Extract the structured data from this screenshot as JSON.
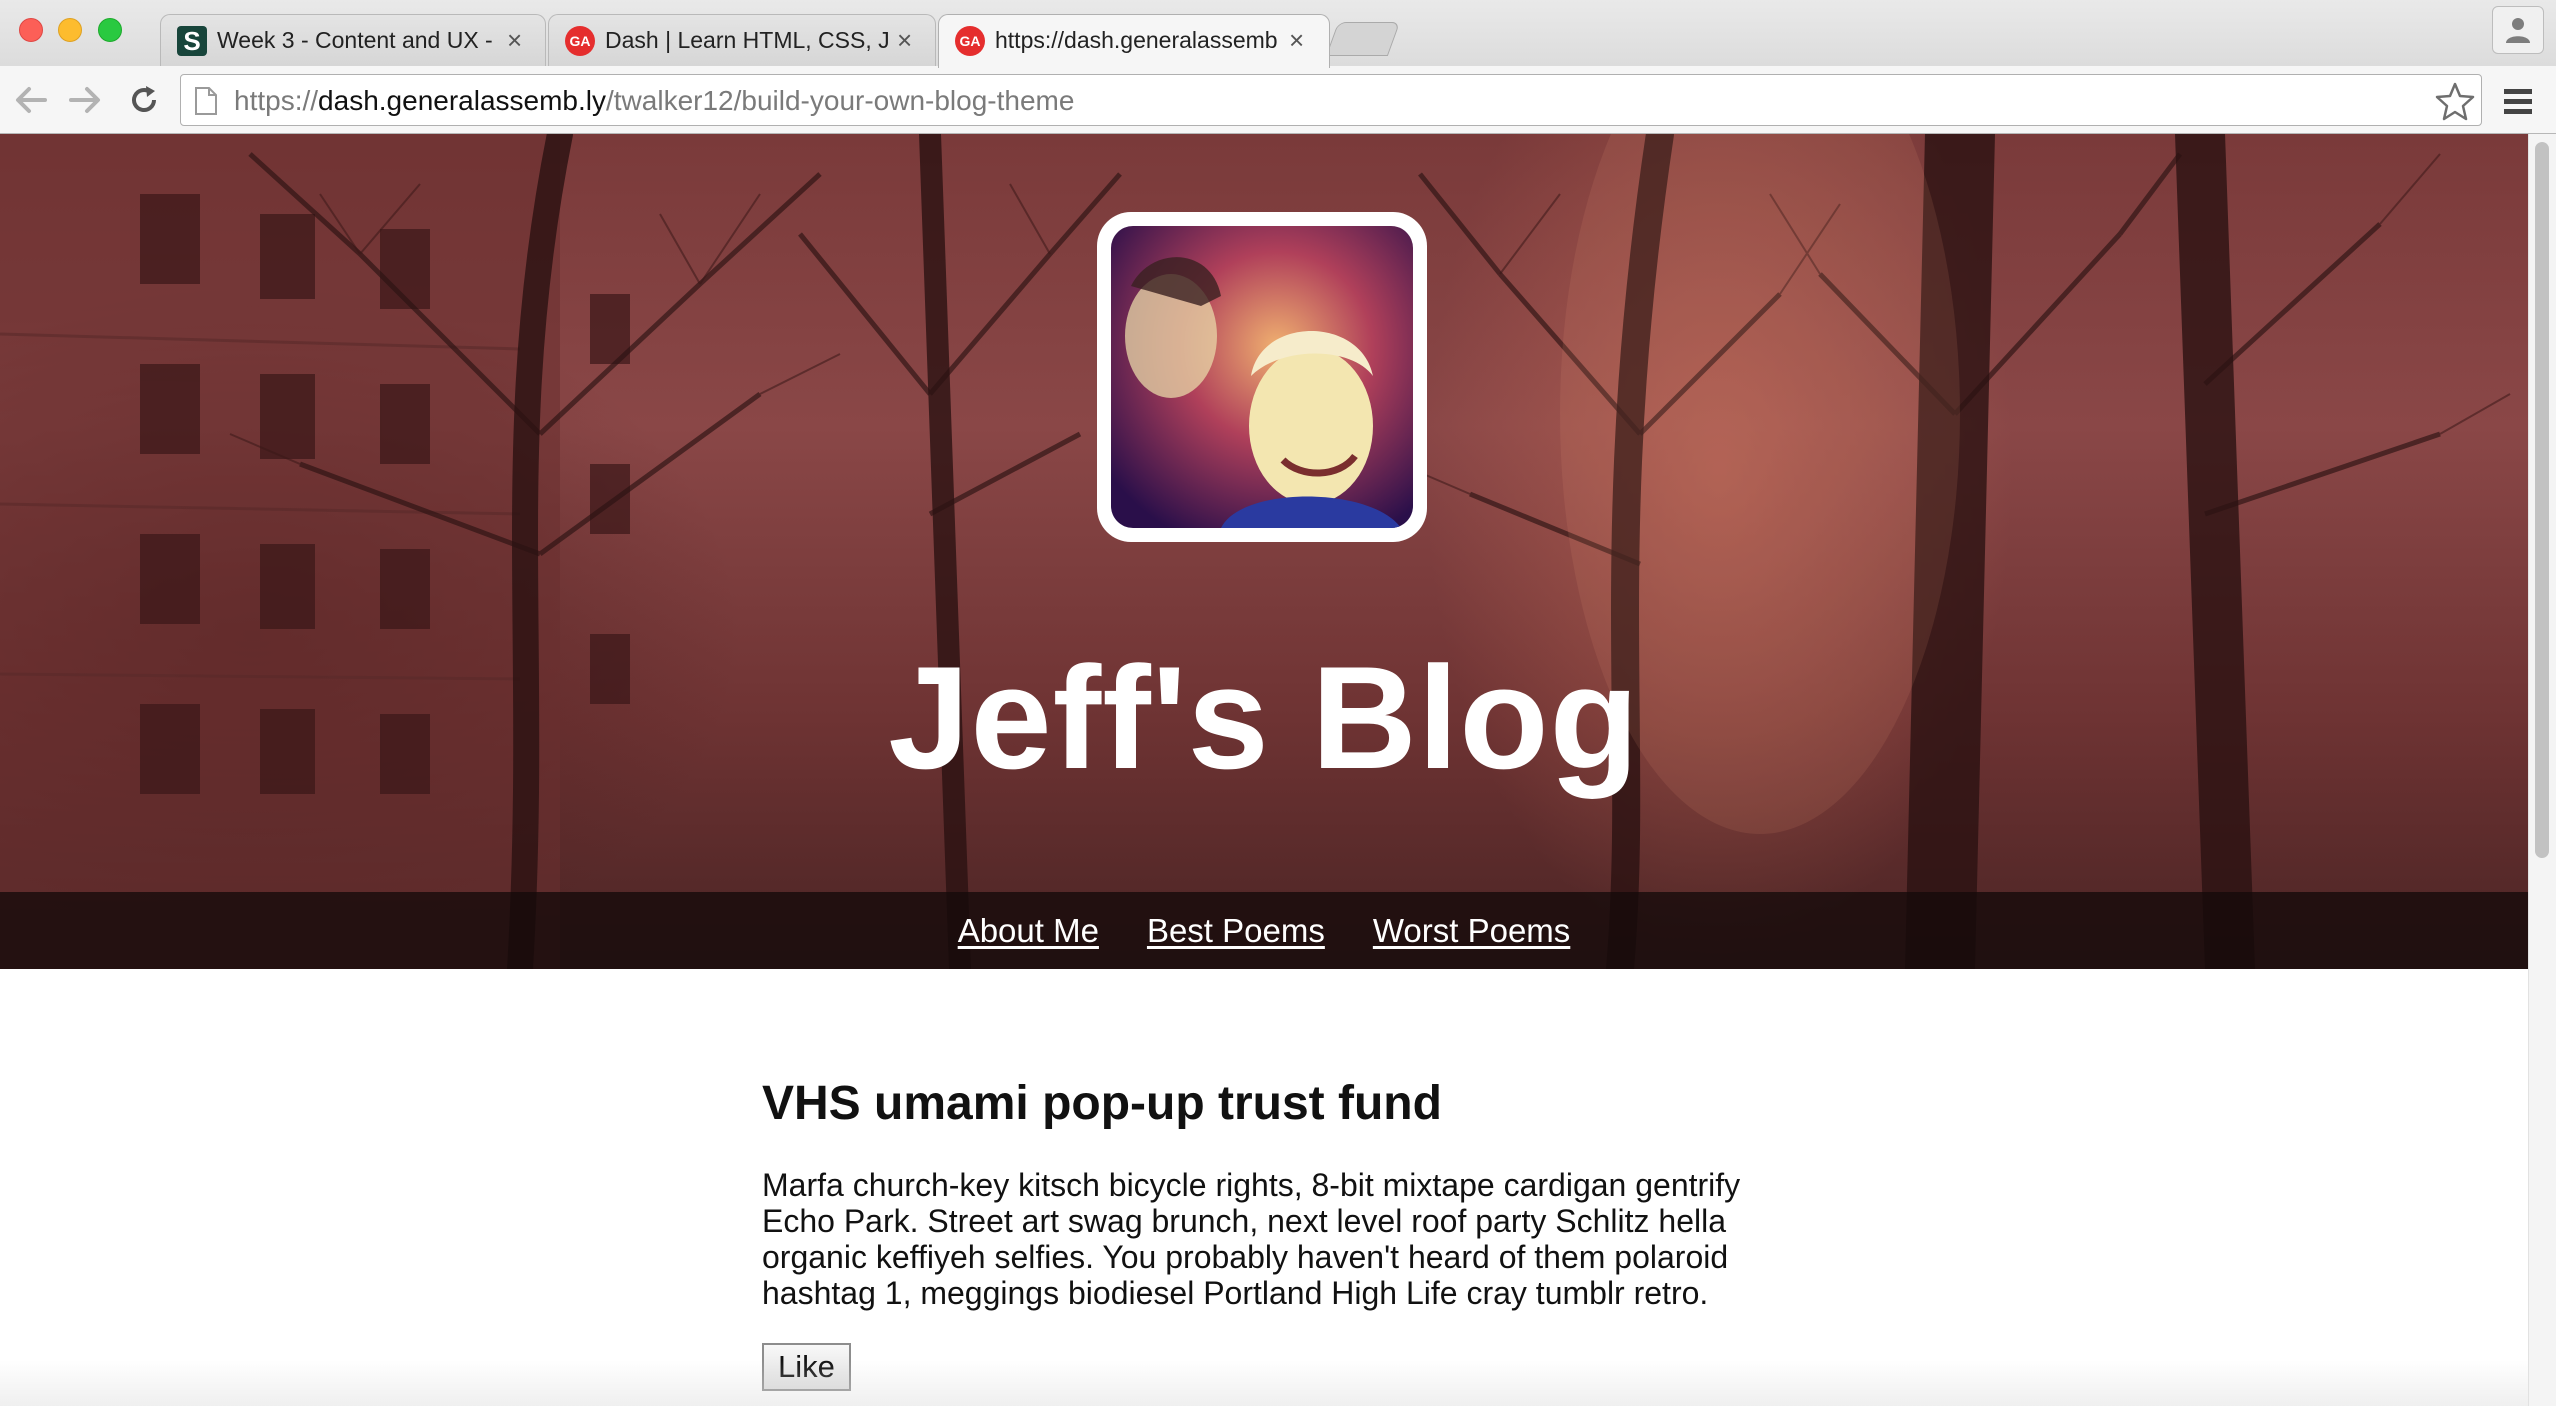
{
  "browser": {
    "tabs": [
      {
        "title": "Week 3 - Content and UX -",
        "favicon": "S"
      },
      {
        "title": "Dash | Learn HTML, CSS, J",
        "favicon": "GA"
      },
      {
        "title": "https://dash.generalassemb",
        "favicon": "GA"
      }
    ],
    "address": {
      "scheme": "https://",
      "host": "dash.generalassemb.ly",
      "path": "/twalker12/build-your-own-blog-theme"
    }
  },
  "blog": {
    "title": "Jeff's Blog",
    "nav": [
      "About Me",
      "Best Poems",
      "Worst Poems"
    ]
  },
  "post": {
    "title": "VHS umami pop-up trust fund",
    "body": "Marfa church-key kitsch bicycle rights, 8-bit mixtape cardigan gentrify Echo Park. Street art swag brunch, next level roof party Schlitz hella organic keffiyeh selfies. You probably haven't heard of them polaroid hashtag 1, meggings biodiesel Portland High Life cray tumblr retro.",
    "like_label": "Like"
  },
  "colors": {
    "hero_tint": "#7a3a3a",
    "nav_bar": "#140a0a",
    "ga_red": "#e52e2e",
    "msu_green": "#18453b"
  },
  "icons": [
    "back-arrow-icon",
    "forward-arrow-icon",
    "reload-icon",
    "page-icon",
    "star-icon",
    "menu-icon",
    "profile-icon",
    "close-icon"
  ]
}
